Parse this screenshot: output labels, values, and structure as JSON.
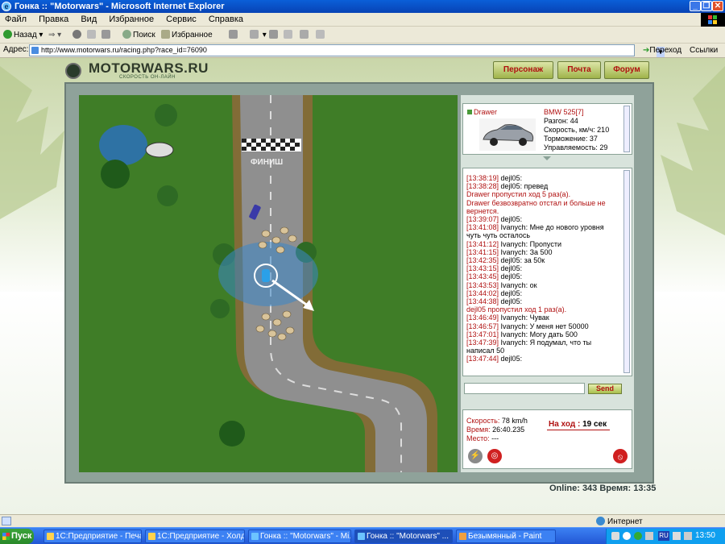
{
  "window": {
    "title": "Гонка :: \"Motorwars\" - Microsoft Internet Explorer",
    "min_glyph": "_",
    "max_glyph": "❐",
    "close_glyph": "✕"
  },
  "menu": [
    "Файл",
    "Правка",
    "Вид",
    "Избранное",
    "Сервис",
    "Справка"
  ],
  "toolbar": {
    "back": "Назад",
    "forward_glyph": "⇒",
    "search": "Поиск",
    "favorites": "Избранное"
  },
  "address": {
    "label": "Адрес:",
    "url": "http://www.motorwars.ru/racing.php?race_id=76090",
    "go": "Переход",
    "links": "Ссылки"
  },
  "site": {
    "logo": "MOTORWARS.RU",
    "tagline": "СКОРОСТЬ ОН-ЛАЙН",
    "nav": [
      "Персонаж",
      "Почта",
      "Форум"
    ]
  },
  "track": {
    "finish_label": "ФИНИШ"
  },
  "car_card": {
    "driver": "Drawer",
    "model": "BMW 525[7]",
    "stats": [
      "Разгон: 44",
      "Скорость, км/ч: 210",
      "Торможение: 37",
      "Управляемость: 29"
    ]
  },
  "chat": {
    "messages": [
      {
        "time": "[13:38:19]",
        "text": " dejl05:",
        "sys": false
      },
      {
        "time": "[13:38:28]",
        "text": " dejl05: превед",
        "sys": false
      },
      {
        "time": "",
        "text": "Drawer пропустил ход 5 раз(а).",
        "sys": true
      },
      {
        "time": "",
        "text": "Drawer безвозвратно отстал и больше не вернется.",
        "sys": true
      },
      {
        "time": "[13:39:07]",
        "text": " dejl05:",
        "sys": false
      },
      {
        "time": "[13:41:08]",
        "text": " Ivanych: Мне до нового уровня чуть чуть осталось",
        "sys": false
      },
      {
        "time": "[13:41:12]",
        "text": " Ivanych: Пропусти",
        "sys": false
      },
      {
        "time": "[13:41:15]",
        "text": " Ivanych: За 500",
        "sys": false
      },
      {
        "time": "[13:42:35]",
        "text": " dejl05: за 50к",
        "sys": false
      },
      {
        "time": "[13:43:15]",
        "text": " dejl05:",
        "sys": false
      },
      {
        "time": "[13:43:45]",
        "text": " dejl05:",
        "sys": false
      },
      {
        "time": "[13:43:53]",
        "text": " Ivanych: ок",
        "sys": false
      },
      {
        "time": "[13:44:02]",
        "text": " dejl05:",
        "sys": false
      },
      {
        "time": "[13:44:38]",
        "text": " dejl05:",
        "sys": false
      },
      {
        "time": "",
        "text": "dejl05 пропустил ход 1 раз(а).",
        "sys": true
      },
      {
        "time": "[13:46:49]",
        "text": " Ivanych: Чувак",
        "sys": false
      },
      {
        "time": "[13:46:57]",
        "text": " Ivanych: У меня нет 50000",
        "sys": false
      },
      {
        "time": "[13:47:01]",
        "text": " Ivanych: Могу дать 500",
        "sys": false
      },
      {
        "time": "[13:47:39]",
        "text": " Ivanych: Я подумал, что ты написал 50",
        "sys": false
      },
      {
        "time": "[13:47:44]",
        "text": " dejl05:",
        "sys": false
      }
    ],
    "send": "Send"
  },
  "status": {
    "speed_label": "Скорость:",
    "speed_value": "78 km/h",
    "time_label": "Время:",
    "time_value": "26:40.235",
    "place_label": "Место:",
    "place_value": "---",
    "turn_label": "На ход :",
    "turn_value": "19 сек"
  },
  "online": "Online: 343  Время: 13:35",
  "statusbar": {
    "zone": "Интернет"
  },
  "taskbar": {
    "start": "Пуск",
    "tasks": [
      "1С:Предприятие - Печа...",
      "1С:Предприятие - Холд...",
      "Гонка :: \"Motorwars\" - Mi...",
      "Гонка :: \"Motorwars\" ...",
      "Безымянный - Paint"
    ],
    "lang": "RU",
    "clock": "13:50"
  },
  "colors": {
    "accent_red": "#b01010",
    "grass": "#3f7d27",
    "road": "#8f8f8f"
  }
}
